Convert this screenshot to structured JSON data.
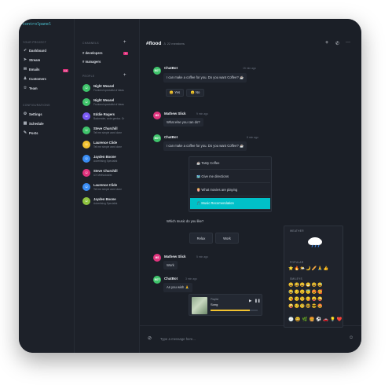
{
  "app": {
    "brand": "controlpanel"
  },
  "nav": {
    "section1_title": "YOUR PROJECT",
    "items": [
      {
        "label": "Dashboard",
        "icon": "rocket-icon"
      },
      {
        "label": "Stream",
        "icon": "send-icon"
      },
      {
        "label": "Emails",
        "icon": "mail-icon",
        "badge": "12"
      },
      {
        "label": "Customers",
        "icon": "users-icon"
      },
      {
        "label": "Team",
        "icon": "star-icon"
      }
    ],
    "section2_title": "CONFIGURATIONS",
    "config_items": [
      {
        "label": "Settings",
        "icon": "gear-icon"
      },
      {
        "label": "Schedule",
        "icon": "calendar-icon"
      },
      {
        "label": "Posts",
        "icon": "pencil-icon"
      }
    ]
  },
  "channels": {
    "title": "CHANNELS",
    "items": [
      {
        "label": "# developers",
        "badge": "3"
      },
      {
        "label": "# managers"
      }
    ],
    "people_title": "PEOPLE",
    "people": [
      {
        "name": "Night Weasel",
        "sub": "Frontend specialist of ideas",
        "initials": "NW",
        "color": "#3fc46b"
      },
      {
        "name": "Night Weasel",
        "sub": "Frontend specialist of ideas",
        "initials": "NW",
        "color": "#3fc46b"
      },
      {
        "name": "Eddie Rogers",
        "sub": "Backender, code genius. Gr",
        "initials": "ER",
        "color": "#7a5af5"
      },
      {
        "name": "Steve Churchill",
        "sub": "Tell me simple word done",
        "initials": "SC",
        "color": "#3fc46b"
      },
      {
        "name": "Laurence Clide",
        "sub": "Tell me simple word done",
        "initials": "LC",
        "color": "#f2c230"
      },
      {
        "name": "Jayden Boone",
        "sub": "Advertising Specialist",
        "initials": "JB",
        "color": "#3a8df5"
      },
      {
        "name": "Steve Churchill",
        "sub": "UX Methodoloist",
        "initials": "SC",
        "color": "#e0337d"
      },
      {
        "name": "Laurence Clide",
        "sub": "Tell me simple word done",
        "initials": "LC",
        "color": "#3a8df5"
      },
      {
        "name": "Jayden Boone",
        "sub": "Advertising Specialist",
        "initials": "JB",
        "color": "#8fc43f"
      }
    ]
  },
  "chat": {
    "title": "#flood",
    "members": "22 members",
    "messages": {
      "m1_name": "ChatBot",
      "m1_time": "15 min ago",
      "m1_text": "I can make a coffee for you. Do you want Coffee? ☕",
      "opt_yes": "😊 Yes",
      "opt_no": "😐 No",
      "m2_name": "Mathew Slick",
      "m2_time": "9 min ago",
      "m2_text": "What else you can do?",
      "m3_name": "ChatBot",
      "m3_time": "8 min ago",
      "m3_text": "I can make a coffee for you. Do you want Coffee? ☕",
      "menu": [
        "☕ Tasty Coffee",
        "🗺️ Give me directions",
        "🍿 What movies are playing",
        "🎵 Music Recomendation"
      ],
      "m3_after": "Which music do you like?",
      "opt_relax": "Relax",
      "opt_work": "Work",
      "m4_name": "Mathew Slick",
      "m4_time": "5 min ago",
      "m4_text": "Work",
      "m5_name": "ChatBot",
      "m5_time": "3 min ago",
      "m5_text": "As you wish 🙏",
      "player_label": "Playlist",
      "player_song": "Song",
      "bot_initials": "BOT",
      "user_initials": "MS"
    },
    "input_placeholder": "Type a message here..."
  },
  "emoji_panel": {
    "weather_title": "WEATHER",
    "popular_title": "POPULAR",
    "popular": "⭐🔥🌤️🌙🥖🙏👍",
    "smileys_title": "SMILEYS",
    "smileys_rows": [
      "😀😃😄😁😆😅",
      "😂🙂😊😇😍🥰",
      "😘😗😚😋😛😜",
      "🤪🤨🧐🤓😎🤩"
    ],
    "tabs": "🕘😀🌿🍔⚽🚗💡❤️"
  },
  "colors": {
    "accent": "#00c0c8",
    "badge": "#e0337d",
    "bot": "#3fc46b",
    "user": "#e0337d"
  }
}
